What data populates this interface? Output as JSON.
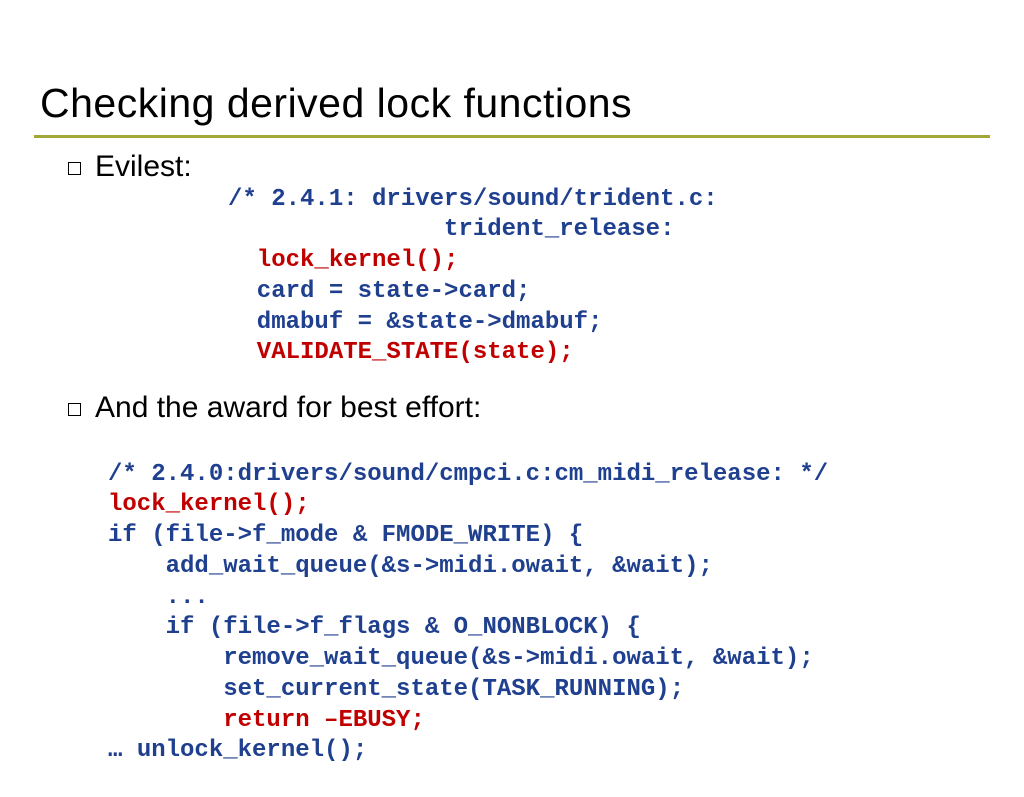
{
  "title": "Checking derived lock functions",
  "bullet1": "Evilest:",
  "bullet2": "And the award for best effort:",
  "code1": {
    "l1": "/* 2.4.1: drivers/sound/trident.c:",
    "l2": "               trident_release:",
    "l3": "  lock_kernel();",
    "l4": "  card = state->card;",
    "l5": "  dmabuf = &state->dmabuf;",
    "l6": "  VALIDATE_STATE(state);"
  },
  "code2": {
    "l1": "/* 2.4.0:drivers/sound/cmpci.c:cm_midi_release: */",
    "l2": "lock_kernel();",
    "l3": "if (file->f_mode & FMODE_WRITE) {",
    "l4": "    add_wait_queue(&s->midi.owait, &wait);",
    "l5": "    ...",
    "l6": "    if (file->f_flags & O_NONBLOCK) {",
    "l7": "        remove_wait_queue(&s->midi.owait, &wait);",
    "l8": "        set_current_state(TASK_RUNNING);",
    "l9a": "        ",
    "l9b": "return –EBUSY;",
    "l10a": "… ",
    "l10b": "unlock_kernel();"
  }
}
